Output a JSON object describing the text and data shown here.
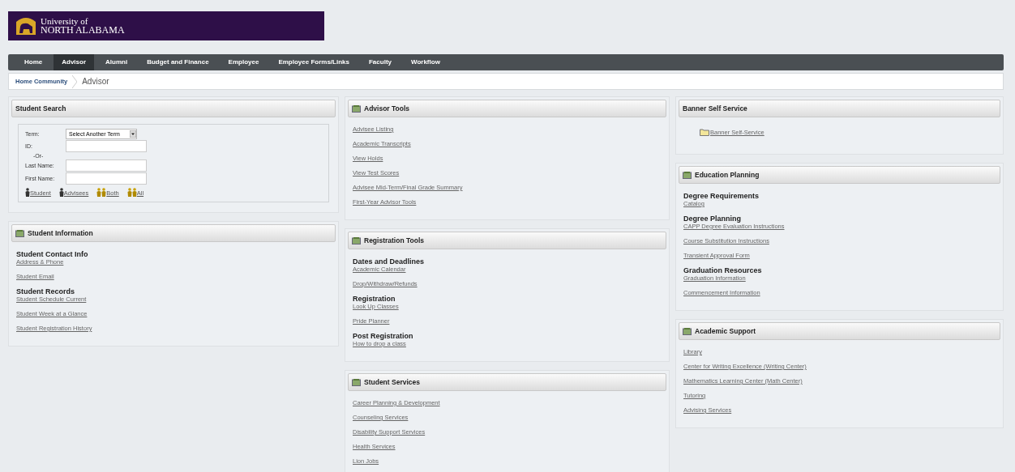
{
  "logo": {
    "line1": "University of",
    "line2": "NORTH ALABAMA"
  },
  "nav": [
    {
      "label": "Home",
      "selected": false
    },
    {
      "label": "Advisor",
      "selected": true
    },
    {
      "label": "Alumni",
      "selected": false
    },
    {
      "label": "Budget and Finance",
      "selected": false
    },
    {
      "label": "Employee",
      "selected": false
    },
    {
      "label": "Employee Forms/Links",
      "selected": false
    },
    {
      "label": "Faculty",
      "selected": false
    },
    {
      "label": "Workflow",
      "selected": false
    }
  ],
  "breadcrumb": {
    "link": "Home Community",
    "current": "Advisor"
  },
  "columns": [
    [
      {
        "kind": "search",
        "title": "Student Search",
        "icon": false,
        "term": {
          "label": "Term:",
          "value": "Select Another Term"
        },
        "id_label": "ID:",
        "or_label": "-Or-",
        "last_label": "Last Name:",
        "first_label": "First Name:",
        "buttons": [
          {
            "label": "Student",
            "kind": "single"
          },
          {
            "label": "Advisees",
            "kind": "single"
          },
          {
            "label": "Both",
            "kind": "pair"
          },
          {
            "label": "All",
            "kind": "pair"
          }
        ]
      },
      {
        "kind": "links",
        "title": "Student Information",
        "icon": true,
        "items": [
          {
            "kind": "heading",
            "text": "Student Contact Info"
          },
          {
            "kind": "link",
            "text": "Address & Phone"
          },
          {
            "kind": "link",
            "text": "Student Email"
          },
          {
            "kind": "heading",
            "text": "Student Records"
          },
          {
            "kind": "link",
            "text": "Student Schedule Current"
          },
          {
            "kind": "link",
            "text": "Student Week at a Glance"
          },
          {
            "kind": "link",
            "text": "Student Registration History"
          }
        ]
      }
    ],
    [
      {
        "kind": "links",
        "title": "Advisor Tools",
        "icon": true,
        "items": [
          {
            "kind": "link",
            "text": "Advisee Listing"
          },
          {
            "kind": "link",
            "text": "Academic Transcripts"
          },
          {
            "kind": "link",
            "text": "View Holds"
          },
          {
            "kind": "link",
            "text": "View Test Scores"
          },
          {
            "kind": "link",
            "text": "Advisee Mid-Term/Final Grade Summary"
          },
          {
            "kind": "link",
            "text": "First-Year  Advisor Tools"
          }
        ]
      },
      {
        "kind": "links",
        "title": "Registration Tools",
        "icon": true,
        "items": [
          {
            "kind": "heading",
            "text": "Dates and Deadlines"
          },
          {
            "kind": "link",
            "text": "Academic Calendar"
          },
          {
            "kind": "link",
            "text": "Drop/Withdraw/Refunds"
          },
          {
            "kind": "heading",
            "text": "Registration"
          },
          {
            "kind": "link",
            "text": "Look Up Classes"
          },
          {
            "kind": "link",
            "text": "Pride Planner"
          },
          {
            "kind": "heading",
            "text": "Post Registration"
          },
          {
            "kind": "link",
            "text": "How to drop a class"
          }
        ]
      },
      {
        "kind": "links",
        "title": "Student Services",
        "icon": true,
        "items": [
          {
            "kind": "link",
            "text": "Career Planning & Development"
          },
          {
            "kind": "link",
            "text": "Counseling Services"
          },
          {
            "kind": "link",
            "text": "Disability Support Services"
          },
          {
            "kind": "link",
            "text": "Health Services"
          },
          {
            "kind": "link",
            "text": "Lion Jobs"
          }
        ]
      }
    ],
    [
      {
        "kind": "banner",
        "title": "Banner Self Service",
        "icon": false,
        "link": "Banner Self-Service"
      },
      {
        "kind": "links",
        "title": "Education Planning",
        "icon": true,
        "items": [
          {
            "kind": "heading",
            "text": "Degree Requirements"
          },
          {
            "kind": "link",
            "text": "Catalog"
          },
          {
            "kind": "heading",
            "text": "Degree Planning"
          },
          {
            "kind": "link",
            "text": "CAPP Degree Evaluation Instructions"
          },
          {
            "kind": "link",
            "text": "Course Substitution Instructions"
          },
          {
            "kind": "link",
            "text": "Transient Approval Form"
          },
          {
            "kind": "heading",
            "text": "Graduation Resources"
          },
          {
            "kind": "link",
            "text": "Graduation Information"
          },
          {
            "kind": "link",
            "text": "Commencement Information"
          }
        ]
      },
      {
        "kind": "links",
        "title": "Academic Support",
        "icon": true,
        "items": [
          {
            "kind": "link",
            "text": "Library"
          },
          {
            "kind": "link",
            "text": "Center for Writing Excellence (Writing Center)"
          },
          {
            "kind": "link",
            "text": "Mathematics Learning Center (Math Center)"
          },
          {
            "kind": "link",
            "text": "Tutoring"
          },
          {
            "kind": "link",
            "text": "Advising Services"
          }
        ]
      }
    ]
  ]
}
